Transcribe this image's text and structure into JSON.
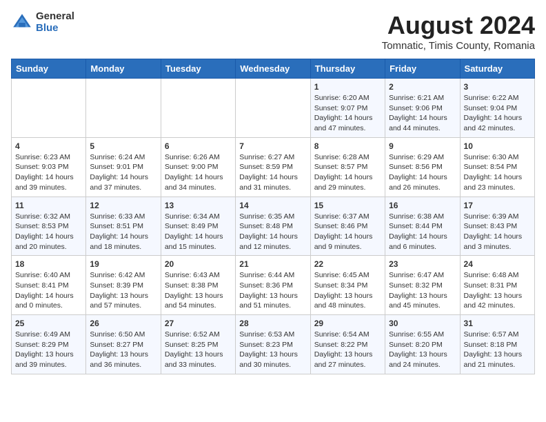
{
  "logo": {
    "general": "General",
    "blue": "Blue"
  },
  "title": {
    "month_year": "August 2024",
    "location": "Tomnatic, Timis County, Romania"
  },
  "weekdays": [
    "Sunday",
    "Monday",
    "Tuesday",
    "Wednesday",
    "Thursday",
    "Friday",
    "Saturday"
  ],
  "weeks": [
    [
      {
        "day": "",
        "info": ""
      },
      {
        "day": "",
        "info": ""
      },
      {
        "day": "",
        "info": ""
      },
      {
        "day": "",
        "info": ""
      },
      {
        "day": "1",
        "info": "Sunrise: 6:20 AM\nSunset: 9:07 PM\nDaylight: 14 hours and 47 minutes."
      },
      {
        "day": "2",
        "info": "Sunrise: 6:21 AM\nSunset: 9:06 PM\nDaylight: 14 hours and 44 minutes."
      },
      {
        "day": "3",
        "info": "Sunrise: 6:22 AM\nSunset: 9:04 PM\nDaylight: 14 hours and 42 minutes."
      }
    ],
    [
      {
        "day": "4",
        "info": "Sunrise: 6:23 AM\nSunset: 9:03 PM\nDaylight: 14 hours and 39 minutes."
      },
      {
        "day": "5",
        "info": "Sunrise: 6:24 AM\nSunset: 9:01 PM\nDaylight: 14 hours and 37 minutes."
      },
      {
        "day": "6",
        "info": "Sunrise: 6:26 AM\nSunset: 9:00 PM\nDaylight: 14 hours and 34 minutes."
      },
      {
        "day": "7",
        "info": "Sunrise: 6:27 AM\nSunset: 8:59 PM\nDaylight: 14 hours and 31 minutes."
      },
      {
        "day": "8",
        "info": "Sunrise: 6:28 AM\nSunset: 8:57 PM\nDaylight: 14 hours and 29 minutes."
      },
      {
        "day": "9",
        "info": "Sunrise: 6:29 AM\nSunset: 8:56 PM\nDaylight: 14 hours and 26 minutes."
      },
      {
        "day": "10",
        "info": "Sunrise: 6:30 AM\nSunset: 8:54 PM\nDaylight: 14 hours and 23 minutes."
      }
    ],
    [
      {
        "day": "11",
        "info": "Sunrise: 6:32 AM\nSunset: 8:53 PM\nDaylight: 14 hours and 20 minutes."
      },
      {
        "day": "12",
        "info": "Sunrise: 6:33 AM\nSunset: 8:51 PM\nDaylight: 14 hours and 18 minutes."
      },
      {
        "day": "13",
        "info": "Sunrise: 6:34 AM\nSunset: 8:49 PM\nDaylight: 14 hours and 15 minutes."
      },
      {
        "day": "14",
        "info": "Sunrise: 6:35 AM\nSunset: 8:48 PM\nDaylight: 14 hours and 12 minutes."
      },
      {
        "day": "15",
        "info": "Sunrise: 6:37 AM\nSunset: 8:46 PM\nDaylight: 14 hours and 9 minutes."
      },
      {
        "day": "16",
        "info": "Sunrise: 6:38 AM\nSunset: 8:44 PM\nDaylight: 14 hours and 6 minutes."
      },
      {
        "day": "17",
        "info": "Sunrise: 6:39 AM\nSunset: 8:43 PM\nDaylight: 14 hours and 3 minutes."
      }
    ],
    [
      {
        "day": "18",
        "info": "Sunrise: 6:40 AM\nSunset: 8:41 PM\nDaylight: 14 hours and 0 minutes."
      },
      {
        "day": "19",
        "info": "Sunrise: 6:42 AM\nSunset: 8:39 PM\nDaylight: 13 hours and 57 minutes."
      },
      {
        "day": "20",
        "info": "Sunrise: 6:43 AM\nSunset: 8:38 PM\nDaylight: 13 hours and 54 minutes."
      },
      {
        "day": "21",
        "info": "Sunrise: 6:44 AM\nSunset: 8:36 PM\nDaylight: 13 hours and 51 minutes."
      },
      {
        "day": "22",
        "info": "Sunrise: 6:45 AM\nSunset: 8:34 PM\nDaylight: 13 hours and 48 minutes."
      },
      {
        "day": "23",
        "info": "Sunrise: 6:47 AM\nSunset: 8:32 PM\nDaylight: 13 hours and 45 minutes."
      },
      {
        "day": "24",
        "info": "Sunrise: 6:48 AM\nSunset: 8:31 PM\nDaylight: 13 hours and 42 minutes."
      }
    ],
    [
      {
        "day": "25",
        "info": "Sunrise: 6:49 AM\nSunset: 8:29 PM\nDaylight: 13 hours and 39 minutes."
      },
      {
        "day": "26",
        "info": "Sunrise: 6:50 AM\nSunset: 8:27 PM\nDaylight: 13 hours and 36 minutes."
      },
      {
        "day": "27",
        "info": "Sunrise: 6:52 AM\nSunset: 8:25 PM\nDaylight: 13 hours and 33 minutes."
      },
      {
        "day": "28",
        "info": "Sunrise: 6:53 AM\nSunset: 8:23 PM\nDaylight: 13 hours and 30 minutes."
      },
      {
        "day": "29",
        "info": "Sunrise: 6:54 AM\nSunset: 8:22 PM\nDaylight: 13 hours and 27 minutes."
      },
      {
        "day": "30",
        "info": "Sunrise: 6:55 AM\nSunset: 8:20 PM\nDaylight: 13 hours and 24 minutes."
      },
      {
        "day": "31",
        "info": "Sunrise: 6:57 AM\nSunset: 8:18 PM\nDaylight: 13 hours and 21 minutes."
      }
    ]
  ]
}
